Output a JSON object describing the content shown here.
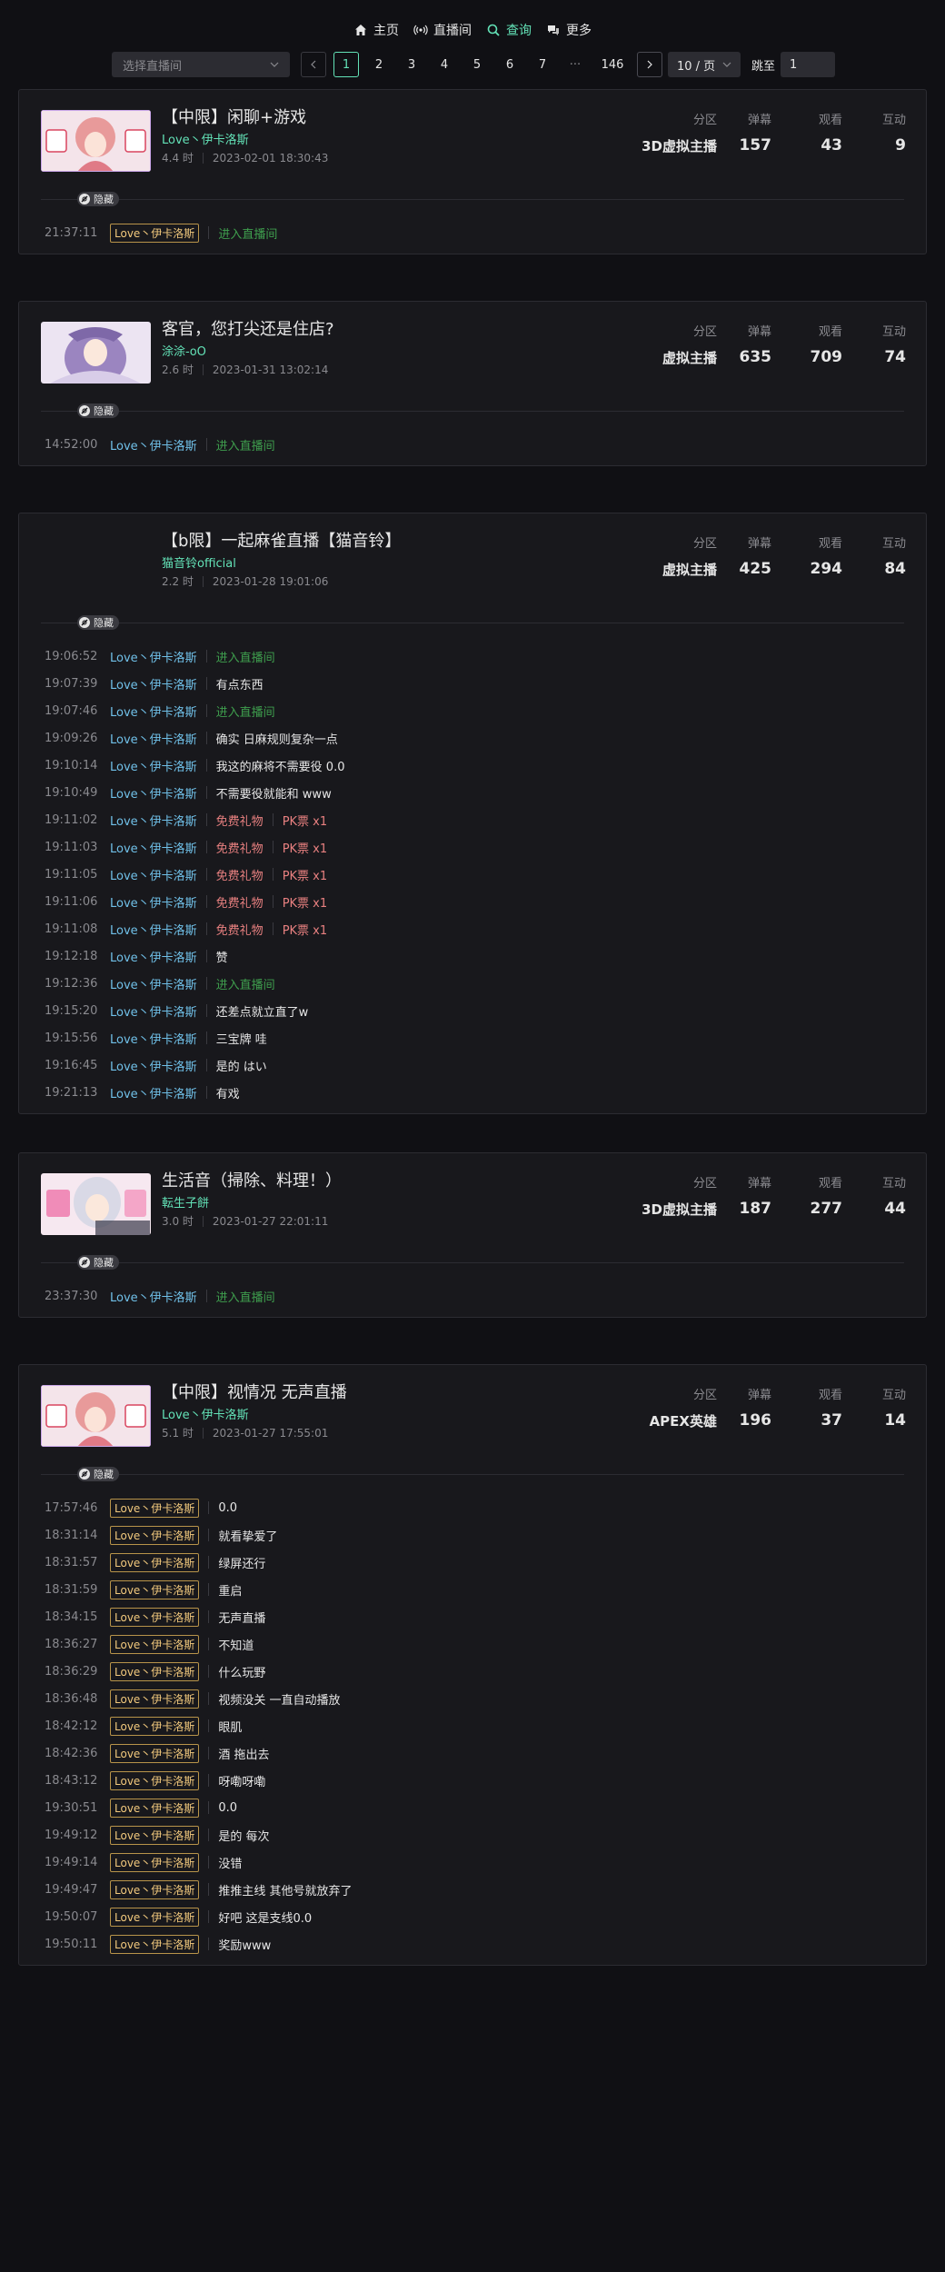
{
  "nav": {
    "items": [
      {
        "label": "主页",
        "icon": "home-icon"
      },
      {
        "label": "直播间",
        "icon": "broadcast-icon"
      },
      {
        "label": "查询",
        "icon": "search-icon"
      },
      {
        "label": "更多",
        "icon": "chat-bubbles-icon"
      }
    ],
    "active_index": 2
  },
  "toolbar": {
    "room_select_placeholder": "选择直播间",
    "pages": [
      "1",
      "2",
      "3",
      "4",
      "5",
      "6",
      "7",
      "···",
      "146"
    ],
    "current_page": "1",
    "page_size": "10 / 页",
    "jump_label": "跳至",
    "jump_value": "1"
  },
  "stat_headers": {
    "area": "分区",
    "danmaku": "弹幕",
    "viewers": "观看",
    "interact": "互动"
  },
  "hide_label": "隐藏",
  "cards": [
    {
      "title": "【中限】闲聊+游戏",
      "uname": "Love丶伊卡洛斯",
      "duration": "4.4 时",
      "time": "2023-02-01 18:30:43",
      "area": "3D虚拟主播",
      "danmaku": "157",
      "viewers": "43",
      "interact": "9",
      "logs": [
        {
          "t": "21:37:11",
          "who": "Love丶伊卡洛斯",
          "badge": true,
          "msg": "进入直播间",
          "kind": "enter"
        }
      ]
    },
    {
      "title": "客官，您打尖还是住店?",
      "uname": "涂涂-oO",
      "duration": "2.6 时",
      "time": "2023-01-31 13:02:14",
      "area": "虚拟主播",
      "danmaku": "635",
      "viewers": "709",
      "interact": "74",
      "logs": [
        {
          "t": "14:52:00",
          "who": "Love丶伊卡洛斯",
          "badge": false,
          "msg": "进入直播间",
          "kind": "enter"
        }
      ]
    },
    {
      "title": "【b限】一起麻雀直播【猫音铃】",
      "uname": "猫音铃official",
      "duration": "2.2 时",
      "time": "2023-01-28 19:01:06",
      "area": "虚拟主播",
      "danmaku": "425",
      "viewers": "294",
      "interact": "84",
      "logs": [
        {
          "t": "19:06:52",
          "who": "Love丶伊卡洛斯",
          "badge": false,
          "msg": "进入直播间",
          "kind": "enter"
        },
        {
          "t": "19:07:39",
          "who": "Love丶伊卡洛斯",
          "badge": false,
          "msg": "有点东西",
          "kind": "text"
        },
        {
          "t": "19:07:46",
          "who": "Love丶伊卡洛斯",
          "badge": false,
          "msg": "进入直播间",
          "kind": "enter"
        },
        {
          "t": "19:09:26",
          "who": "Love丶伊卡洛斯",
          "badge": false,
          "msg": "确实 日麻规则复杂一点",
          "kind": "text"
        },
        {
          "t": "19:10:14",
          "who": "Love丶伊卡洛斯",
          "badge": false,
          "msg": "我这的麻将不需要役 0.0",
          "kind": "text"
        },
        {
          "t": "19:10:49",
          "who": "Love丶伊卡洛斯",
          "badge": false,
          "msg": "不需要役就能和 www",
          "kind": "text"
        },
        {
          "t": "19:11:02",
          "who": "Love丶伊卡洛斯",
          "badge": false,
          "msg": "免费礼物",
          "gift": "PK票 x1",
          "kind": "gift"
        },
        {
          "t": "19:11:03",
          "who": "Love丶伊卡洛斯",
          "badge": false,
          "msg": "免费礼物",
          "gift": "PK票 x1",
          "kind": "gift"
        },
        {
          "t": "19:11:05",
          "who": "Love丶伊卡洛斯",
          "badge": false,
          "msg": "免费礼物",
          "gift": "PK票 x1",
          "kind": "gift"
        },
        {
          "t": "19:11:06",
          "who": "Love丶伊卡洛斯",
          "badge": false,
          "msg": "免费礼物",
          "gift": "PK票 x1",
          "kind": "gift"
        },
        {
          "t": "19:11:08",
          "who": "Love丶伊卡洛斯",
          "badge": false,
          "msg": "免费礼物",
          "gift": "PK票 x1",
          "kind": "gift"
        },
        {
          "t": "19:12:18",
          "who": "Love丶伊卡洛斯",
          "badge": false,
          "msg": "赞",
          "kind": "text"
        },
        {
          "t": "19:12:36",
          "who": "Love丶伊卡洛斯",
          "badge": false,
          "msg": "进入直播间",
          "kind": "enter"
        },
        {
          "t": "19:15:20",
          "who": "Love丶伊卡洛斯",
          "badge": false,
          "msg": "还差点就立直了w",
          "kind": "text"
        },
        {
          "t": "19:15:56",
          "who": "Love丶伊卡洛斯",
          "badge": false,
          "msg": "三宝牌 哇",
          "kind": "text"
        },
        {
          "t": "19:16:45",
          "who": "Love丶伊卡洛斯",
          "badge": false,
          "msg": "是的 はい",
          "kind": "text"
        },
        {
          "t": "19:21:13",
          "who": "Love丶伊卡洛斯",
          "badge": false,
          "msg": "有戏",
          "kind": "text"
        }
      ]
    },
    {
      "title": "生活音（掃除、料理！）",
      "uname": "転生子餅",
      "duration": "3.0 时",
      "time": "2023-01-27 22:01:11",
      "area": "3D虚拟主播",
      "danmaku": "187",
      "viewers": "277",
      "interact": "44",
      "logs": [
        {
          "t": "23:37:30",
          "who": "Love丶伊卡洛斯",
          "badge": false,
          "msg": "进入直播间",
          "kind": "enter"
        }
      ]
    },
    {
      "title": "【中限】视情况 无声直播",
      "uname": "Love丶伊卡洛斯",
      "duration": "5.1 时",
      "time": "2023-01-27 17:55:01",
      "area": "APEX英雄",
      "danmaku": "196",
      "viewers": "37",
      "interact": "14",
      "logs": [
        {
          "t": "17:57:46",
          "who": "Love丶伊卡洛斯",
          "badge": true,
          "msg": "0.0",
          "kind": "text"
        },
        {
          "t": "18:31:14",
          "who": "Love丶伊卡洛斯",
          "badge": true,
          "msg": "就看挚爱了",
          "kind": "text"
        },
        {
          "t": "18:31:57",
          "who": "Love丶伊卡洛斯",
          "badge": true,
          "msg": "绿屏还行",
          "kind": "text"
        },
        {
          "t": "18:31:59",
          "who": "Love丶伊卡洛斯",
          "badge": true,
          "msg": "重启",
          "kind": "text"
        },
        {
          "t": "18:34:15",
          "who": "Love丶伊卡洛斯",
          "badge": true,
          "msg": "无声直播",
          "kind": "text"
        },
        {
          "t": "18:36:27",
          "who": "Love丶伊卡洛斯",
          "badge": true,
          "msg": "不知道",
          "kind": "text"
        },
        {
          "t": "18:36:29",
          "who": "Love丶伊卡洛斯",
          "badge": true,
          "msg": "什么玩野",
          "kind": "text"
        },
        {
          "t": "18:36:48",
          "who": "Love丶伊卡洛斯",
          "badge": true,
          "msg": "视频没关 一直自动播放",
          "kind": "text"
        },
        {
          "t": "18:42:12",
          "who": "Love丶伊卡洛斯",
          "badge": true,
          "msg": "眼肌",
          "kind": "text"
        },
        {
          "t": "18:42:36",
          "who": "Love丶伊卡洛斯",
          "badge": true,
          "msg": "酒 拖出去",
          "kind": "text"
        },
        {
          "t": "18:43:12",
          "who": "Love丶伊卡洛斯",
          "badge": true,
          "msg": "呀嘞呀嘞",
          "kind": "text"
        },
        {
          "t": "19:30:51",
          "who": "Love丶伊卡洛斯",
          "badge": true,
          "msg": "0.0",
          "kind": "text"
        },
        {
          "t": "19:49:12",
          "who": "Love丶伊卡洛斯",
          "badge": true,
          "msg": "是的 每次",
          "kind": "text"
        },
        {
          "t": "19:49:14",
          "who": "Love丶伊卡洛斯",
          "badge": true,
          "msg": "没错",
          "kind": "text"
        },
        {
          "t": "19:49:47",
          "who": "Love丶伊卡洛斯",
          "badge": true,
          "msg": "推推主线 其他号就放弃了",
          "kind": "text"
        },
        {
          "t": "19:50:07",
          "who": "Love丶伊卡洛斯",
          "badge": true,
          "msg": "好吧 这是支线0.0",
          "kind": "text"
        },
        {
          "t": "19:50:11",
          "who": "Love丶伊卡洛斯",
          "badge": true,
          "msg": "奖励www",
          "kind": "text"
        }
      ]
    }
  ],
  "colors": {
    "accent": "#63e2b7",
    "user": "#70c0e8",
    "enter": "#3f9f4e",
    "gift": "#e88080",
    "badge": "#f2c97d"
  }
}
